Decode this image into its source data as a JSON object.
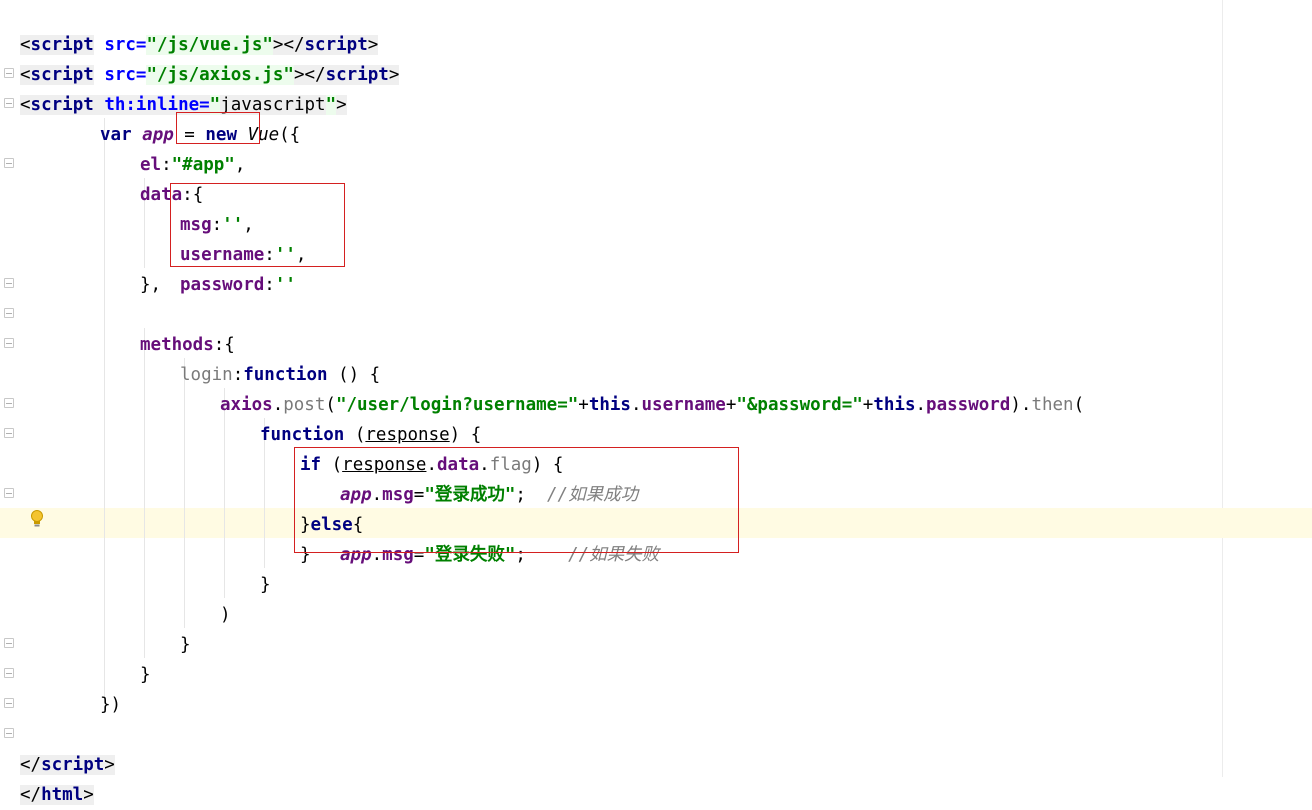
{
  "editor": {
    "language": "html+javascript",
    "highlighted_line": 18
  },
  "code": {
    "script_vue": {
      "open": "<",
      "tag": "script",
      "attr": "src=",
      "value": "\"/js/vue.js\"",
      "close": "></",
      "tag2": "script",
      "end": ">"
    },
    "script_axios": {
      "open": "<",
      "tag": "script",
      "attr": "src=",
      "value": "\"/js/axios.js\"",
      "close": "></",
      "tag2": "script",
      "end": ">"
    },
    "script_inline": {
      "open": "<",
      "tag": "script",
      "attr": "th:inline=",
      "q1": "\"",
      "value": "javascript",
      "q2": "\"",
      "end": ">"
    },
    "l4": {
      "var": "var",
      "name": "app",
      "eq": " = ",
      "new": "new",
      "cls": "Vue",
      "tail": "({"
    },
    "l5": {
      "key": "el",
      "colon": ":",
      "value": "\"#app\"",
      "comma": ","
    },
    "l6": {
      "key": "data",
      "tail": ":{"
    },
    "l7": {
      "key": "msg",
      "colon": ":",
      "value": "''",
      "comma": ","
    },
    "l8": {
      "key": "username",
      "colon": ":",
      "value": "''",
      "comma": ","
    },
    "l9": {
      "key": "password",
      "colon": ":",
      "value": "''"
    },
    "l10": {
      "text": "},"
    },
    "l11": {
      "key": "methods",
      "tail": ":{"
    },
    "l12": {
      "name": "login",
      "colon": ":",
      "fn": "function",
      "tail": " () {"
    },
    "l13": {
      "obj": "axios",
      "dot": ".",
      "method": "post",
      "open": "(",
      "s1": "\"/user/login?username=\"",
      "plus1": "+",
      "this1": "this",
      "d1": ".",
      "p1": "username",
      "plus2": "+",
      "s2": "\"&password=\"",
      "plus3": "+",
      "this2": "this",
      "d2": ".",
      "p2": "password",
      "close": ")",
      "d3": ".",
      "then": "then",
      "open2": "("
    },
    "l14": {
      "fn": "function",
      "open": " (",
      "param": "response",
      "tail": ") {"
    },
    "l15": {
      "kw": "if",
      "open": " (",
      "param": "response",
      "d1": ".",
      "p1": "data",
      "d2": ".",
      "p2": "flag",
      "tail": ") {"
    },
    "l16": {
      "obj": "app",
      "dot": ".",
      "prop": "msg",
      "eq": "=",
      "value": "\"登录成功\"",
      "semi": ";",
      "comment": "  //如果成功"
    },
    "l17": {
      "brace": "}",
      "kw": "else",
      "tail": "{"
    },
    "l18": {
      "obj": "app",
      "dot": ".",
      "prop": "msg",
      "eq": "=",
      "value": "\"登录失败\"",
      "semi": ";",
      "comment": "    //如果失败"
    },
    "l19": {
      "text": "}"
    },
    "l20": {
      "text": "}"
    },
    "l21": {
      "text": ")"
    },
    "l22": {
      "text": "}"
    },
    "l23": {
      "text": "}"
    },
    "l24": {
      "text": "})"
    },
    "close_script": {
      "open": "</",
      "tag": "script",
      "end": ">"
    },
    "close_html": {
      "open": "</",
      "tag": "html",
      "end": ">"
    }
  },
  "colors": {
    "annotation_box": "#d42020",
    "caret_line": "#fffbe3",
    "string": "#008000",
    "keyword": "#000080",
    "property": "#660e7a",
    "comment": "#808080"
  },
  "icons": {
    "gutter_hint": "lightbulb-icon",
    "fold_marker": "fold-icon"
  }
}
